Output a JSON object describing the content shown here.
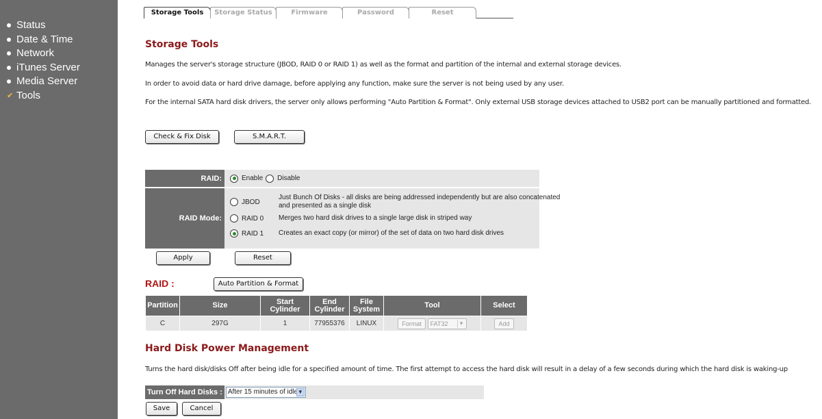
{
  "sidebar": {
    "items": [
      {
        "label": "Status",
        "marker": "bullet"
      },
      {
        "label": "Date & Time",
        "marker": "bullet"
      },
      {
        "label": "Network",
        "marker": "bullet"
      },
      {
        "label": "iTunes Server",
        "marker": "bullet"
      },
      {
        "label": "Media Server",
        "marker": "bullet"
      },
      {
        "label": "Tools",
        "marker": "check"
      }
    ]
  },
  "tabs": [
    {
      "label": "Storage Tools",
      "active": true
    },
    {
      "label": "Storage Status",
      "active": false
    },
    {
      "label": "Firmware",
      "active": false
    },
    {
      "label": "Password",
      "active": false
    },
    {
      "label": "Reset",
      "active": false
    }
  ],
  "main": {
    "title": "Storage Tools",
    "paragraphs": [
      "Manages the server's storage structure (JBOD, RAID 0 or RAID 1) as well as the format and partition of the internal and external storage devices.",
      "In order to avoid data or hard drive damage, before applying any function, make sure the server is not being used by any user.",
      "For the internal SATA hard disk drivers, the server only allows performing \"Auto Partition & Format\". Only external USB storage devices attached to USB2 port can be manually partitioned and formatted."
    ],
    "check_fix_label": "Check & Fix Disk",
    "smart_label": "S.M.A.R.T."
  },
  "raid_settings": {
    "raid_label": "RAID:",
    "enable_label": "Enable",
    "disable_label": "Disable",
    "raid_enabled": true,
    "mode_label": "RAID Mode:",
    "modes": [
      {
        "name": "JBOD",
        "desc": "Just Bunch Of Disks - all disks are being addressed independently but are also concatenated and presented as a single disk",
        "selected": false
      },
      {
        "name": "RAID 0",
        "desc": "Merges two hard disk drives to a single large disk in striped way",
        "selected": false
      },
      {
        "name": "RAID 1",
        "desc": "Creates an exact copy (or mirror) of the set of data on two hard disk drives",
        "selected": true
      }
    ],
    "apply_label": "Apply",
    "reset_label": "Reset"
  },
  "raid_table": {
    "title": "RAID :",
    "auto_partition_label": "Auto Partition & Format",
    "headers": [
      "Partition",
      "Size",
      "Start Cylinder",
      "End Cylinder",
      "File System",
      "Tool",
      "Select"
    ],
    "rows": [
      {
        "partition": "C",
        "size": "297G",
        "start": "1",
        "end": "77955376",
        "fs": "LINUX",
        "format_label": "Format",
        "fs_option": "FAT32",
        "add_label": "Add"
      }
    ]
  },
  "power": {
    "title": "Hard Disk Power Management",
    "description": "Turns the hard disk/disks Off after being idle for a specified amount of time. The first attempt to access the hard disk will result in a delay of a few seconds during which the hard disk is waking-up",
    "turn_off_label": "Turn Off Hard Disks :",
    "turn_off_value": "After 15 minutes of idle",
    "save_label": "Save",
    "cancel_label": "Cancel"
  },
  "colors": {
    "sidebar_bg": "#6b6b6b",
    "heading_red": "#8b1a1a",
    "panel_bg": "#e6e6e6"
  }
}
